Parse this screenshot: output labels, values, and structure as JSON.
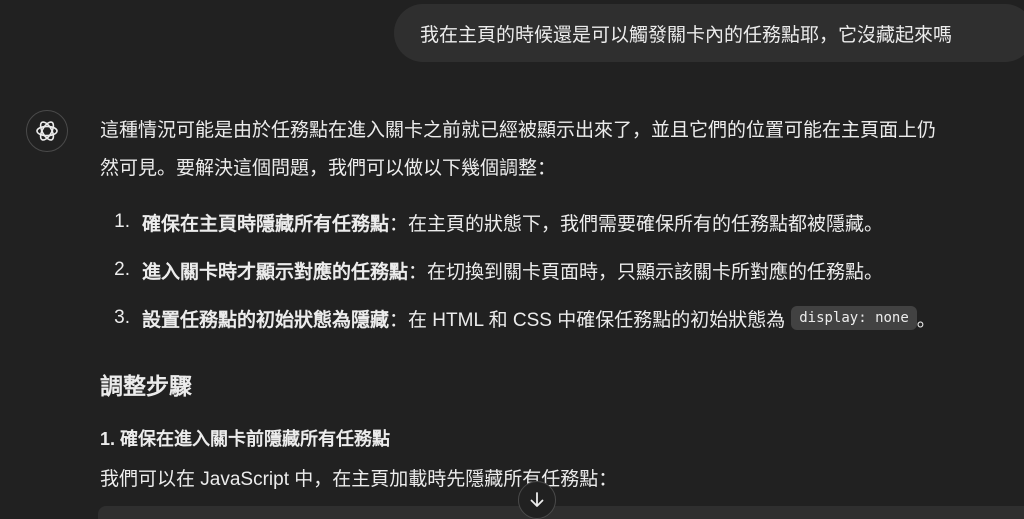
{
  "user_message": "我在主頁的時候還是可以觸發關卡內的任務點耶，它沒藏起來嗎",
  "assistant": {
    "intro_line1": "這種情況可能是由於任務點在進入關卡之前就已經被顯示出來了，並且它們的位置可能在主頁面上仍",
    "intro_line2": "然可見。要解決這個問題，我們可以做以下幾個調整：",
    "list": [
      {
        "num": "1.",
        "bold": "確保在主頁時隱藏所有任務點",
        "text": "：在主頁的狀態下，我們需要確保所有的任務點都被隱藏。"
      },
      {
        "num": "2.",
        "bold": "進入關卡時才顯示對應的任務點",
        "text": "：在切換到關卡頁面時，只顯示該關卡所對應的任務點。"
      },
      {
        "num": "3.",
        "bold": "設置任務點的初始狀態為隱藏",
        "text": "：在 HTML 和 CSS 中確保任務點的初始狀態為",
        "code": "display: none",
        "tail": "。"
      }
    ],
    "heading": "調整步驟",
    "subheading": "1. 確保在進入關卡前隱藏所有任務點",
    "para": "我們可以在 JavaScript 中，在主頁加載時先隱藏所有任務點："
  },
  "icons": {
    "avatar": "chatgpt-logo-icon",
    "scroll": "arrow-down-icon"
  }
}
